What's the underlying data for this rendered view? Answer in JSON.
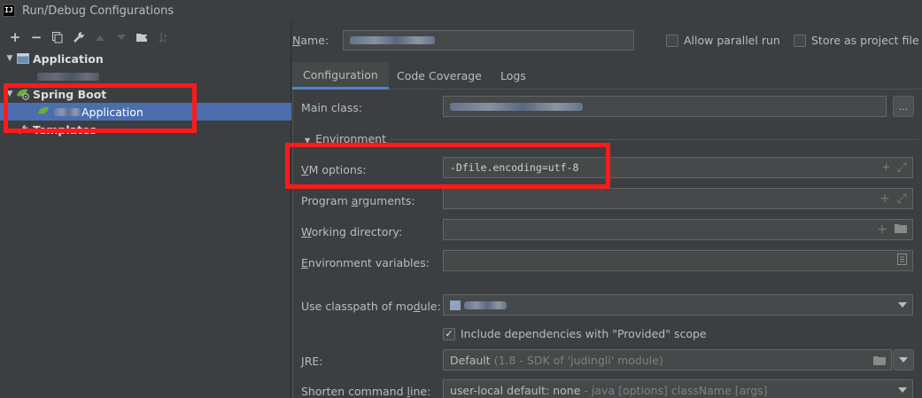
{
  "window": {
    "title": "Run/Debug Configurations",
    "app_icon_text": "IJ"
  },
  "toolbar": {
    "add": "+",
    "remove": "−"
  },
  "tree": {
    "application": {
      "label": "Application"
    },
    "spring_boot": {
      "label": "Spring Boot"
    },
    "spring_child": {
      "label_suffix": "Application"
    },
    "templates": {
      "label": "Templates"
    }
  },
  "header": {
    "name_label": "Name:",
    "allow_parallel_label": "Allow parallel run",
    "store_as_file_label": "Store as project file"
  },
  "tabs": [
    "Configuration",
    "Code Coverage",
    "Logs"
  ],
  "config": {
    "main_class_label": "Main class:",
    "browse_label": "...",
    "environment_label": "Environment",
    "vm_options_label": "VM options:",
    "vm_options_value": "-Dfile.encoding=utf-8",
    "program_args_label": "Program arguments:",
    "working_dir_label": "Working directory:",
    "env_vars_label": "Environment variables:",
    "classpath_label": "Use classpath of module:",
    "include_deps_label": "Include dependencies with \"Provided\" scope",
    "jre_label": "JRE:",
    "jre_value": "Default",
    "jre_hint": "(1.8 - SDK of 'judingli' module)",
    "shorten_label": "Shorten command line:",
    "shorten_value": "user-local default: none",
    "shorten_hint": "- java [options] className [args]"
  },
  "colors": {
    "background": "#3c3f41",
    "selection": "#4b6eaf",
    "highlight": "#ff1a1a",
    "tab_underline": "#4a88c7"
  }
}
